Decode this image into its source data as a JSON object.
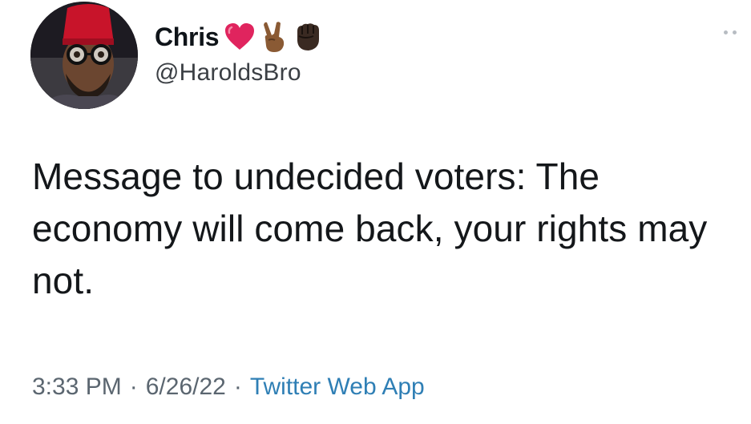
{
  "author": {
    "display_name": "Chris",
    "handle": "@HaroldsBro",
    "name_emojis": [
      "heart-icon",
      "victory-hand-icon",
      "raised-fist-icon"
    ]
  },
  "tweet": {
    "text": "Message to undecided voters: The economy will come back, your rights may not.",
    "time": "3:33 PM",
    "date": "6/26/22",
    "source": "Twitter Web App",
    "separator": "·"
  },
  "colors": {
    "source_link": "#2f7fb5",
    "meta_text": "#5b6670",
    "heart": "#e0245e"
  }
}
